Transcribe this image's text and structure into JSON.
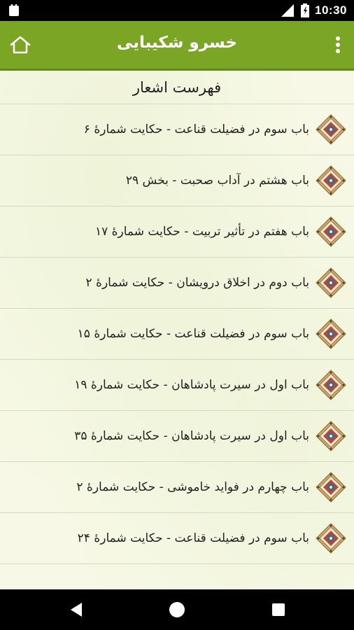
{
  "status_bar": {
    "time": "10:30",
    "icons": [
      "notification-icon",
      "signal-icon",
      "battery-icon"
    ]
  },
  "app_bar": {
    "title": "خسرو شکیبایی",
    "left_icon": "home-icon",
    "right_icon": "more-vert-icon",
    "color": "#7ba524"
  },
  "list": {
    "header": "فهرست اشعار",
    "items": [
      {
        "label": "باب سوم در فضیلت قناعت - حکایت شمارهٔ ۶"
      },
      {
        "label": "باب هشتم در آداب صحبت - بخش ۲۹"
      },
      {
        "label": "باب هفتم در تأثیر تربیت - حکایت شمارهٔ ۱۷"
      },
      {
        "label": "باب دوم در اخلاق درویشان - حکایت شمارهٔ ۲"
      },
      {
        "label": "باب سوم در فضیلت قناعت - حکایت شمارهٔ ۱۵"
      },
      {
        "label": "باب اول در سیرت پادشاهان - حکایت شمارهٔ ۱۹"
      },
      {
        "label": "باب اول در سیرت پادشاهان - حکایت شمارهٔ ۳۵"
      },
      {
        "label": "باب چهارم در فواید خاموشی - حکایت شمارهٔ ۲"
      },
      {
        "label": "باب سوم در فضیلت قناعت - حکایت شمارهٔ ۲۴"
      }
    ],
    "item_icon": "ornament-icon"
  },
  "nav_bar": {
    "icons": [
      "back-icon",
      "home-circle-icon",
      "recents-icon"
    ]
  }
}
